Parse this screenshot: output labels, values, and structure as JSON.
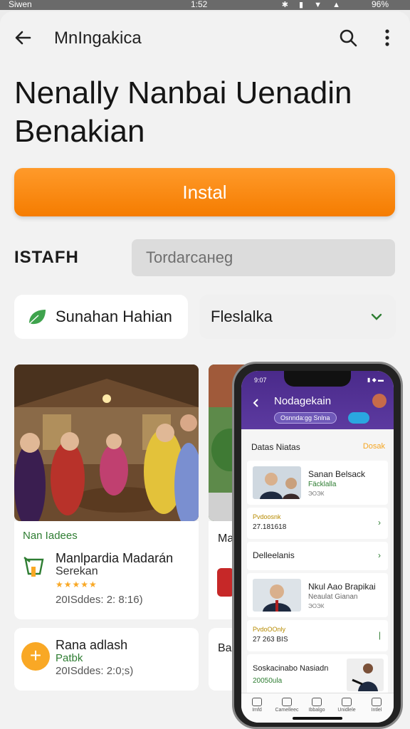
{
  "status_bar": {
    "left": "Siwen",
    "time": "1:52",
    "battery": "96%"
  },
  "topbar": {
    "title": "MnIngakica"
  },
  "headline": "Nenally Nanbai Uenadin Benakian",
  "install_label": "Instal",
  "section_label": "ISTAFH",
  "field": {
    "placeholder": "Tordarcaнeg"
  },
  "chip_label": "Sunahan Hahian",
  "select_value": "Fleslalka",
  "card": {
    "tag": "Nan Iadees",
    "app_name": "Manlpardia Madarán",
    "app_sub": "Serekan",
    "stars": "★★★★★",
    "meta": "20ISddes: 2: 8:16)"
  },
  "card2": {
    "name": "Rana adlash",
    "sub": "Patbk",
    "meta": "20ISddes: 2:0;s)"
  },
  "side": {
    "text1": "Ma",
    "text2": "Ba"
  },
  "phone": {
    "time": "9:07",
    "title": "Nodagekain",
    "pill": "Osnnda:gg Snlna",
    "section_title": "Datas Niatas",
    "section_link": "Dosak",
    "item1": {
      "name": "Sanan Belsack",
      "sub": "Fäcklalla",
      "sub2": "ЭОЭК"
    },
    "row1": {
      "small": "Pvdoosnk",
      "num": "27.181618"
    },
    "row2": {
      "label": "Delleelanis"
    },
    "item2": {
      "name": "Nkul Aao Brapikai",
      "sub": "Neaulat Gianan",
      "sub2": "ЭОЭК"
    },
    "row3": {
      "small": "PvdoOOnly",
      "num": "27 263 BIS"
    },
    "item3": {
      "name": "Soskacinabo Nasiadn",
      "sub": "20050ula"
    },
    "nav": [
      "Imfd",
      "Camelleec",
      "Ibbalgo",
      "Unidlele",
      "Intlel"
    ]
  },
  "colors": {
    "accent": "#f57c00",
    "phone_header": "#4a2a8a",
    "green": "#2e7d32",
    "star": "#f9a825"
  }
}
